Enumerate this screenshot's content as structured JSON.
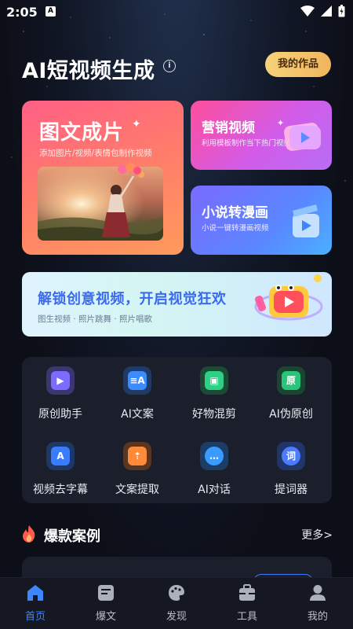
{
  "status_bar": {
    "time": "2:05",
    "app_icon_letter": "A"
  },
  "header": {
    "title": "AI短视频生成",
    "works_button": "我的作品"
  },
  "feature_cards": {
    "main": {
      "title": "图文成片",
      "subtitle": "添加图片/视频/表情包制作视频"
    },
    "marketing": {
      "title": "营销视频",
      "subtitle": "利用模板制作当下热门视频"
    },
    "novel": {
      "title": "小说转漫画",
      "subtitle": "小说一键转漫画视频"
    }
  },
  "banner": {
    "title": "解锁创意视频，开启视觉狂欢",
    "subtitle": "图生视频 · 照片跳舞 · 照片唱歌"
  },
  "tools": [
    {
      "label": "原创助手",
      "icon": "video-camera-icon",
      "color": "#7c6bff"
    },
    {
      "label": "AI文案",
      "icon": "ai-text-icon",
      "color": "#3a8cff"
    },
    {
      "label": "好物混剪",
      "icon": "video-edit-icon",
      "color": "#2fcf84"
    },
    {
      "label": "AI伪原创",
      "icon": "original-doc-icon",
      "color": "#29c47a"
    },
    {
      "label": "视频去字幕",
      "icon": "subtitle-remove-icon",
      "color": "#3b7cff"
    },
    {
      "label": "文案提取",
      "icon": "extract-icon",
      "color": "#ff8a3a"
    },
    {
      "label": "AI对话",
      "icon": "chat-icon",
      "color": "#3a9bff"
    },
    {
      "label": "提词器",
      "icon": "teleprompter-icon",
      "color": "#4b7cff"
    }
  ],
  "section": {
    "title": "爆款案例",
    "more": "更多>"
  },
  "tabbar": [
    {
      "label": "首页",
      "icon": "home-icon",
      "active": true
    },
    {
      "label": "爆文",
      "icon": "article-icon",
      "active": false
    },
    {
      "label": "发现",
      "icon": "palette-icon",
      "active": false
    },
    {
      "label": "工具",
      "icon": "toolbox-icon",
      "active": false
    },
    {
      "label": "我的",
      "icon": "profile-icon",
      "active": false
    }
  ],
  "colors": {
    "accent": "#3d86ff",
    "works_button": "#f4c66b",
    "background": "#0d0f18"
  }
}
